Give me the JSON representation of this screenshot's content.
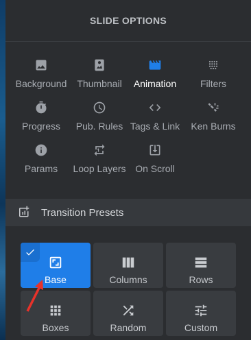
{
  "header": {
    "title": "SLIDE OPTIONS"
  },
  "options": [
    {
      "label": "Background",
      "icon": "image-icon"
    },
    {
      "label": "Thumbnail",
      "icon": "thumbnail-icon"
    },
    {
      "label": "Animation",
      "icon": "clapperboard-icon",
      "active": true
    },
    {
      "label": "Filters",
      "icon": "grain-icon"
    },
    {
      "label": "Progress",
      "icon": "timer-icon"
    },
    {
      "label": "Pub. Rules",
      "icon": "clock-icon"
    },
    {
      "label": "Tags & Link",
      "icon": "code-icon"
    },
    {
      "label": "Ken Burns",
      "icon": "ken-burns-icon"
    },
    {
      "label": "Params",
      "icon": "info-icon"
    },
    {
      "label": "Loop Layers",
      "icon": "loop-icon"
    },
    {
      "label": "On Scroll",
      "icon": "download-box-icon"
    }
  ],
  "section": {
    "title": "Transition Presets",
    "icon": "add-box-icon"
  },
  "presets": [
    {
      "label": "Base",
      "icon": "aspect-icon",
      "selected": true
    },
    {
      "label": "Columns",
      "icon": "columns-icon"
    },
    {
      "label": "Rows",
      "icon": "rows-icon"
    },
    {
      "label": "Boxes",
      "icon": "boxes-icon"
    },
    {
      "label": "Random",
      "icon": "shuffle-icon"
    },
    {
      "label": "Custom",
      "icon": "tune-icon"
    }
  ],
  "colors": {
    "accent": "#1f7ee8",
    "panel": "#2b2d30",
    "tile": "#393c40",
    "annotation_arrow": "#e8322a"
  }
}
